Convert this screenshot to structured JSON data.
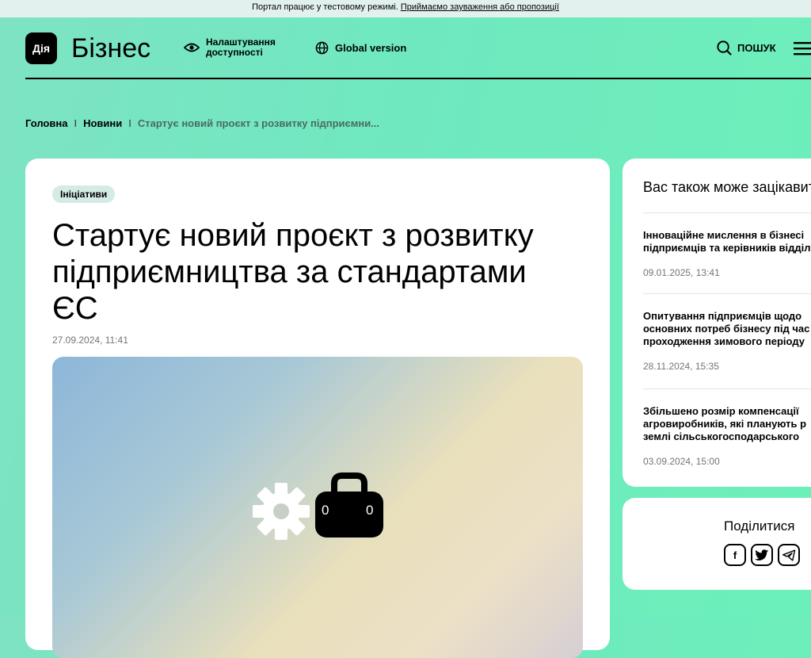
{
  "notice": {
    "text": "Портал працює у тестовому режимі.",
    "link": "Приймаємо зауваження або пропозиції"
  },
  "header": {
    "logo": "Дія",
    "brand": "Бізнес",
    "accessibility_line1": "Налаштування",
    "accessibility_line2": "доступності",
    "global": "Global version",
    "search": "ПОШУК"
  },
  "breadcrumb": {
    "home": "Головна",
    "news": "Новини",
    "current": "Стартує новий проєкт з розвитку підприємни..."
  },
  "article": {
    "tag": "Ініціативи",
    "title": "Стартує новий проєкт з розвитку підприємництва за стандартами ЄС",
    "date": "27.09.2024, 11:41",
    "case_digit_left": "0",
    "case_digit_right": "0"
  },
  "related": {
    "heading": "Вас також може зацікавити",
    "items": [
      {
        "line1": "Інноваційне мислення в бізнесі",
        "line2": "підприємців та керівників відділ",
        "line3": "",
        "date": "09.01.2025, 13:41"
      },
      {
        "line1": "Опитування підприємців щодо",
        "line2": "основних потреб бізнесу під час",
        "line3": "проходження зимового періоду",
        "date": "28.11.2024, 15:35"
      },
      {
        "line1": "Збільшено розмір компенсації",
        "line2": "агровиробників, які планують р",
        "line3": "землі сільськогосподарського",
        "date": "03.09.2024, 15:00"
      }
    ]
  },
  "share": {
    "label": "Поділитися",
    "facebook": "f"
  },
  "colors": {
    "accent": "#6fe8c0",
    "tag_bg": "#d4ebe6"
  }
}
